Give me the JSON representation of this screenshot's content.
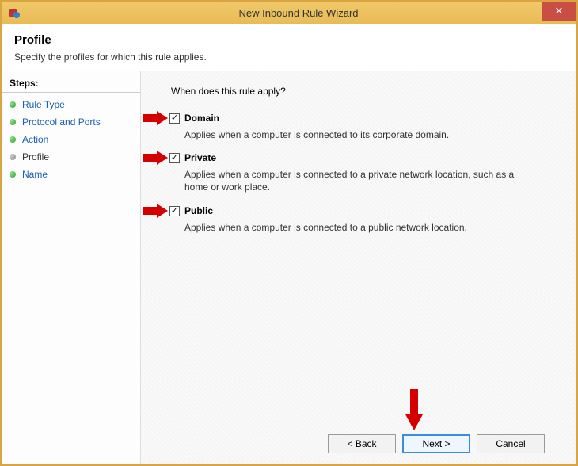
{
  "window": {
    "title": "New Inbound Rule Wizard",
    "close_glyph": "✕"
  },
  "header": {
    "title": "Profile",
    "subtitle": "Specify the profiles for which this rule applies."
  },
  "sidebar": {
    "steps_label": "Steps:",
    "items": [
      {
        "label": "Rule Type",
        "current": false
      },
      {
        "label": "Protocol and Ports",
        "current": false
      },
      {
        "label": "Action",
        "current": false
      },
      {
        "label": "Profile",
        "current": true
      },
      {
        "label": "Name",
        "current": false
      }
    ]
  },
  "main": {
    "question": "When does this rule apply?",
    "profiles": [
      {
        "label": "Domain",
        "checked": true,
        "desc": "Applies when a computer is connected to its corporate domain."
      },
      {
        "label": "Private",
        "checked": true,
        "desc": "Applies when a computer is connected to a private network location, such as a home or work place."
      },
      {
        "label": "Public",
        "checked": true,
        "desc": "Applies when a computer is connected to a public network location."
      }
    ]
  },
  "footer": {
    "back": "< Back",
    "next": "Next >",
    "cancel": "Cancel"
  }
}
